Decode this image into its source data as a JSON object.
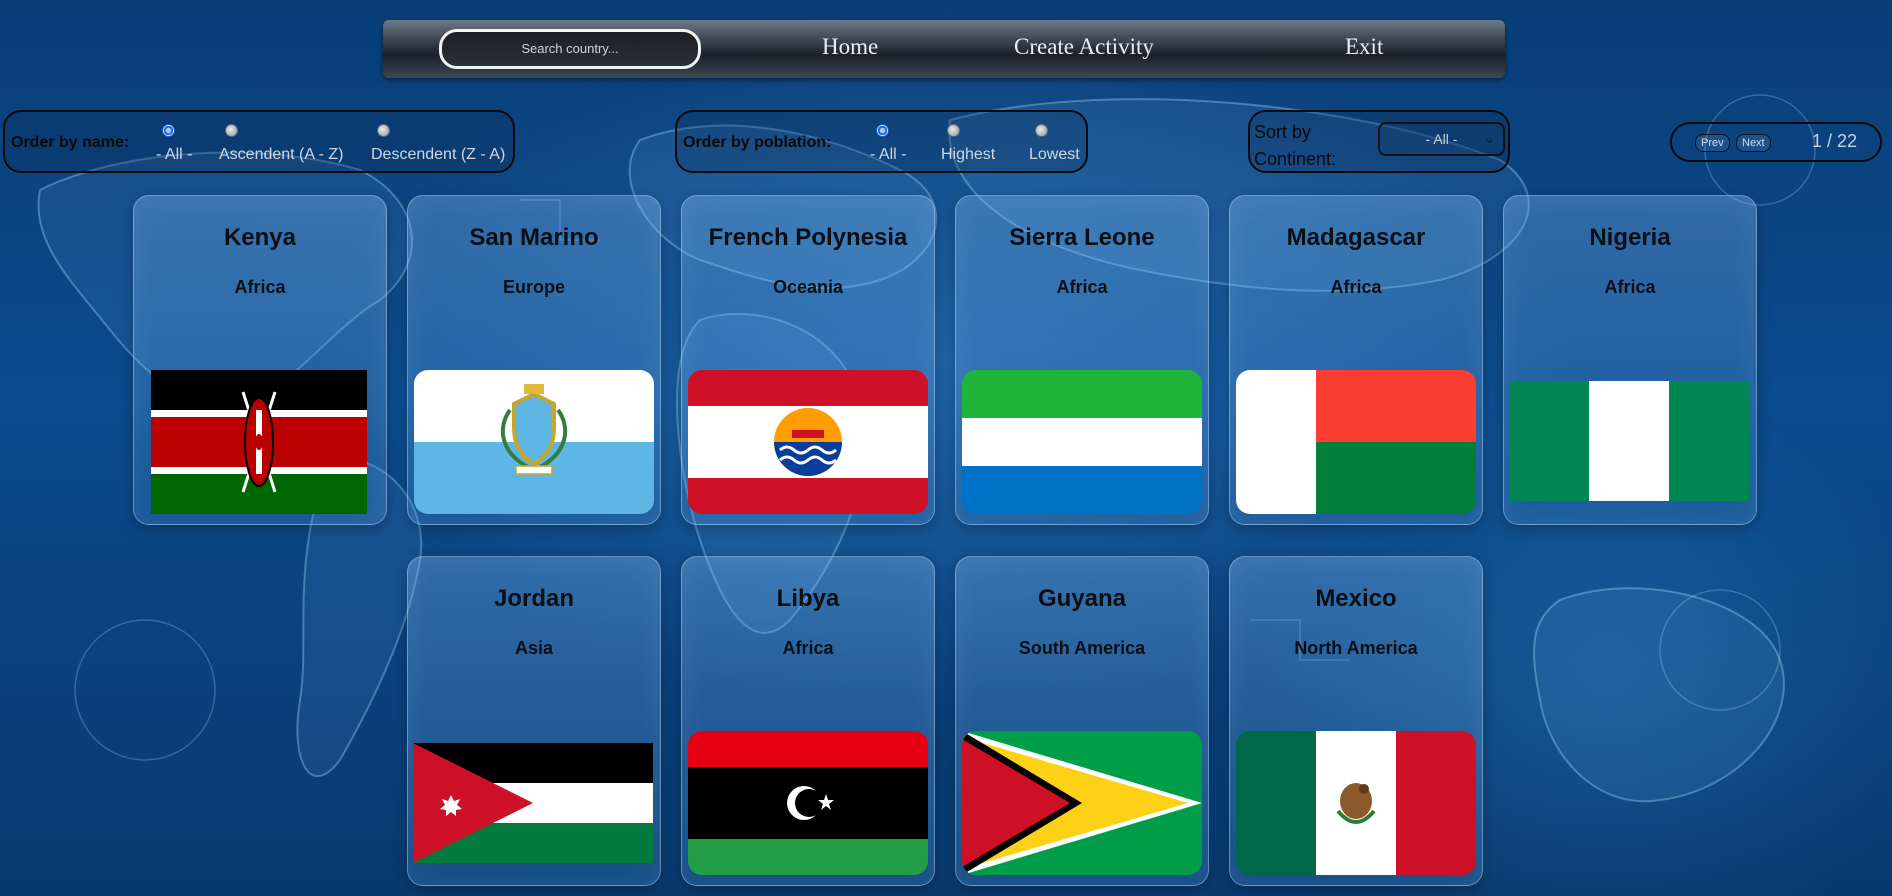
{
  "navbar": {
    "search_placeholder": "Search country...",
    "links": [
      "Home",
      "Create Activity",
      "Exit"
    ]
  },
  "filters": {
    "name": {
      "label": "Order by name:",
      "options": [
        "- All -",
        "Ascendent (A - Z)",
        "Descendent (Z - A)"
      ],
      "selected": "- All -"
    },
    "population": {
      "label": "Order by poblation:",
      "options": [
        "- All -",
        "Highest",
        "Lowest"
      ],
      "selected": "- All -"
    },
    "continent": {
      "label_line1": "Sort by",
      "label_line2": "Continent:",
      "selected": "- All -"
    }
  },
  "pagination": {
    "prev": "Prev",
    "next": "Next",
    "page_text": "1 / 22"
  },
  "countries": [
    {
      "name": "Kenya",
      "continent": "Africa",
      "flag": "kenya-flag"
    },
    {
      "name": "San Marino",
      "continent": "Europe",
      "flag": "san-marino-flag"
    },
    {
      "name": "French Polynesia",
      "continent": "Oceania",
      "flag": "french-polynesia-flag"
    },
    {
      "name": "Sierra Leone",
      "continent": "Africa",
      "flag": "sierra-leone-flag"
    },
    {
      "name": "Madagascar",
      "continent": "Africa",
      "flag": "madagascar-flag"
    },
    {
      "name": "Nigeria",
      "continent": "Africa",
      "flag": "nigeria-flag"
    },
    {
      "name": "Jordan",
      "continent": "Asia",
      "flag": "jordan-flag"
    },
    {
      "name": "Libya",
      "continent": "Africa",
      "flag": "libya-flag"
    },
    {
      "name": "Guyana",
      "continent": "South America",
      "flag": "guyana-flag"
    },
    {
      "name": "Mexico",
      "continent": "North America",
      "flag": "mexico-flag"
    }
  ],
  "colors": {
    "background": "#0b4a8c",
    "card_border": "#bedcff",
    "text_dark": "#0b0f14"
  }
}
